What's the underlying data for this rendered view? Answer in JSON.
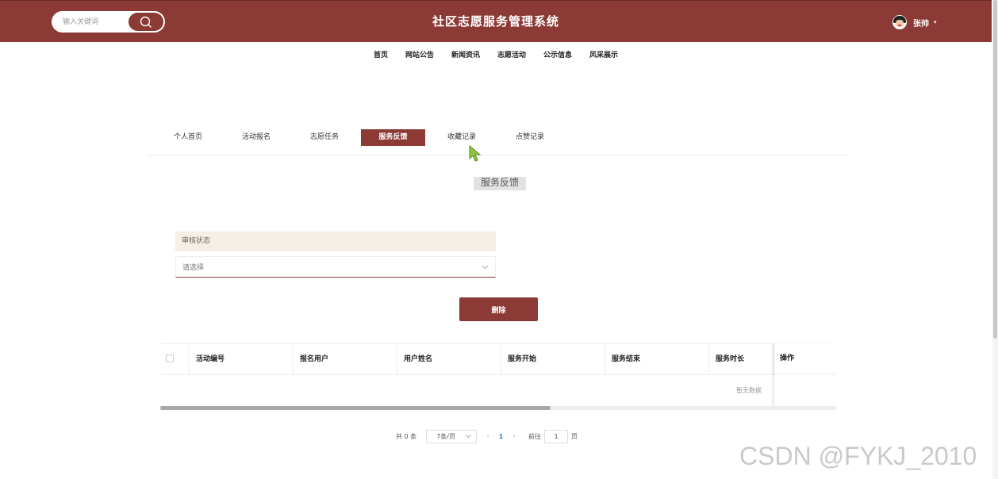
{
  "header": {
    "title": "社区志愿服务管理系统",
    "search_placeholder": "输入关键词",
    "user_name": "张帅",
    "user_caret": "▾",
    "brand_color": "#8b3a36"
  },
  "main_nav": [
    "首页",
    "网站公告",
    "新闻资讯",
    "志愿活动",
    "公示信息",
    "风采展示"
  ],
  "sub_tabs": [
    {
      "label": "个人首页",
      "active": false
    },
    {
      "label": "活动报名",
      "active": false
    },
    {
      "label": "志愿任务",
      "active": false
    },
    {
      "label": "服务反馈",
      "active": true
    },
    {
      "label": "收藏记录",
      "active": false
    },
    {
      "label": "点赞记录",
      "active": false
    }
  ],
  "section_title": "服务反馈",
  "filter": {
    "label": "审核状态",
    "placeholder": "请选择",
    "chevron_icon": "chevron-down-icon"
  },
  "delete_label": "删除",
  "table": {
    "columns": [
      "活动编号",
      "报名用户",
      "用户姓名",
      "服务开始",
      "服务结束",
      "服务时长"
    ],
    "op_column": "操作",
    "empty_text": "暂无数据"
  },
  "pagination": {
    "total": "共 0 条",
    "page_size": "7条/页",
    "prev": "‹",
    "current_page": "1",
    "next": "›",
    "goto_label": "前往",
    "goto_value": "1",
    "page_unit": "页"
  },
  "watermark": "CSDN @FYKJ_2010"
}
